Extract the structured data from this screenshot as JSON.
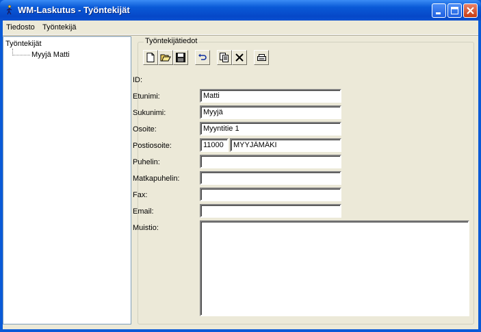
{
  "window": {
    "title": "WM-Laskutus - Työntekijät"
  },
  "menu": {
    "items": [
      "Tiedosto",
      "Työntekijä"
    ]
  },
  "tree": {
    "root": "Työntekijät",
    "children": [
      "Myyjä Matti"
    ]
  },
  "group": {
    "title": "Työntekijätiedot"
  },
  "toolbar": {
    "buttons": [
      "new-icon",
      "open-icon",
      "save-icon",
      "undo-icon",
      "copy-icon",
      "delete-icon",
      "print-icon"
    ]
  },
  "form": {
    "id_label": "ID:",
    "id_value": "",
    "etunimi_label": "Etunimi:",
    "etunimi": "Matti",
    "sukunimi_label": "Sukunimi:",
    "sukunimi": "Myyjä",
    "osoite_label": "Osoite:",
    "osoite": "Myyntitie 1",
    "postiosoite_label": "Postiosoite:",
    "postinumero": "11000",
    "postitoimipaikka": "MYYJÄMÄKI",
    "puhelin_label": "Puhelin:",
    "puhelin": "",
    "matkapuhelin_label": "Matkapuhelin:",
    "matkapuhelin": "",
    "fax_label": "Fax:",
    "fax": "",
    "email_label": "Email:",
    "email": "",
    "muistio_label": "Muistio:",
    "muistio": ""
  },
  "colors": {
    "titlebar": "#0a5ad7",
    "face": "#ece9d8",
    "close": "#c63a12"
  }
}
